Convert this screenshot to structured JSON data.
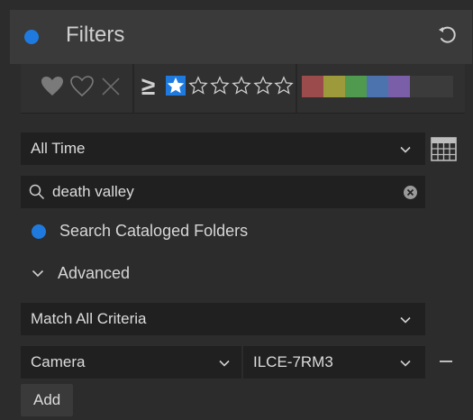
{
  "header": {
    "title": "Filters",
    "dot_color": "#1f7ae0",
    "reset_icon": "undo-arrow-icon"
  },
  "ratings": {
    "comparator": "≥",
    "selected_rating": 1,
    "max_rating": 5
  },
  "color_labels": [
    "#9b4b4b",
    "#9c9a3a",
    "#4f9a4f",
    "#4c73ad",
    "#7b5ea8",
    "#3b3b3b"
  ],
  "date_filter": {
    "value": "All Time"
  },
  "search": {
    "value": "death valley"
  },
  "checkbox": {
    "label": "Search Cataloged Folders",
    "checked": true
  },
  "advanced": {
    "label": "Advanced",
    "expanded": true
  },
  "criteria": {
    "match": "Match All Criteria",
    "field": "Camera",
    "value": "ILCE-7RM3"
  },
  "add_button": {
    "label": "Add"
  }
}
